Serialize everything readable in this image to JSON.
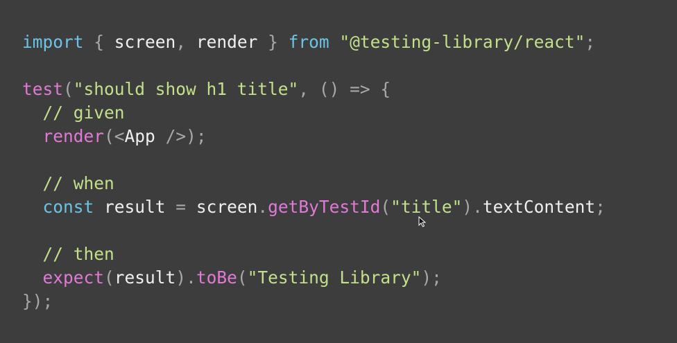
{
  "code": {
    "lines": [
      [
        {
          "t": "import",
          "c": "kw-blue"
        },
        {
          "t": " ",
          "c": "plain"
        },
        {
          "t": "{",
          "c": "punct"
        },
        {
          "t": " screen",
          "c": "plain"
        },
        {
          "t": ",",
          "c": "punct"
        },
        {
          "t": " render ",
          "c": "plain"
        },
        {
          "t": "}",
          "c": "punct"
        },
        {
          "t": " ",
          "c": "plain"
        },
        {
          "t": "from",
          "c": "kw-blue"
        },
        {
          "t": " ",
          "c": "plain"
        },
        {
          "t": "\"@testing-library/react\"",
          "c": "str"
        },
        {
          "t": ";",
          "c": "punct"
        }
      ],
      [],
      [
        {
          "t": "test",
          "c": "kw-pink"
        },
        {
          "t": "(",
          "c": "punct"
        },
        {
          "t": "\"should show h1 title\"",
          "c": "str"
        },
        {
          "t": ", ",
          "c": "punct"
        },
        {
          "t": "() => {",
          "c": "punct"
        }
      ],
      [
        {
          "t": "  ",
          "c": "plain"
        },
        {
          "t": "// given",
          "c": "comment"
        }
      ],
      [
        {
          "t": "  ",
          "c": "plain"
        },
        {
          "t": "render",
          "c": "kw-pink"
        },
        {
          "t": "(<",
          "c": "punct"
        },
        {
          "t": "App",
          "c": "plain"
        },
        {
          "t": " />);",
          "c": "punct"
        }
      ],
      [],
      [
        {
          "t": "  ",
          "c": "plain"
        },
        {
          "t": "// when",
          "c": "comment"
        }
      ],
      [
        {
          "t": "  ",
          "c": "plain"
        },
        {
          "t": "const",
          "c": "kw-blue"
        },
        {
          "t": " result ",
          "c": "plain"
        },
        {
          "t": "=",
          "c": "punct"
        },
        {
          "t": " screen",
          "c": "plain"
        },
        {
          "t": ".",
          "c": "punct"
        },
        {
          "t": "getByTestId",
          "c": "kw-pink"
        },
        {
          "t": "(",
          "c": "punct"
        },
        {
          "t": "\"title\"",
          "c": "str"
        },
        {
          "t": ").",
          "c": "punct"
        },
        {
          "t": "textContent",
          "c": "plain"
        },
        {
          "t": ";",
          "c": "punct"
        }
      ],
      [],
      [
        {
          "t": "  ",
          "c": "plain"
        },
        {
          "t": "// then",
          "c": "comment"
        }
      ],
      [
        {
          "t": "  ",
          "c": "plain"
        },
        {
          "t": "expect",
          "c": "kw-pink"
        },
        {
          "t": "(",
          "c": "punct"
        },
        {
          "t": "result",
          "c": "plain"
        },
        {
          "t": ").",
          "c": "punct"
        },
        {
          "t": "toBe",
          "c": "kw-pink"
        },
        {
          "t": "(",
          "c": "punct"
        },
        {
          "t": "\"Testing Library\"",
          "c": "str"
        },
        {
          "t": ");",
          "c": "punct"
        }
      ],
      [
        {
          "t": "});",
          "c": "punct"
        }
      ]
    ]
  },
  "cursor": {
    "icon": "mouse-pointer-icon"
  },
  "colors": {
    "background": "#3d3d3d",
    "keyword_blue": "#6cc3e6",
    "keyword_pink": "#e07ad6",
    "string_green": "#c2e08a",
    "punctuation": "#a8a8a8",
    "text": "#f0f0f0"
  }
}
